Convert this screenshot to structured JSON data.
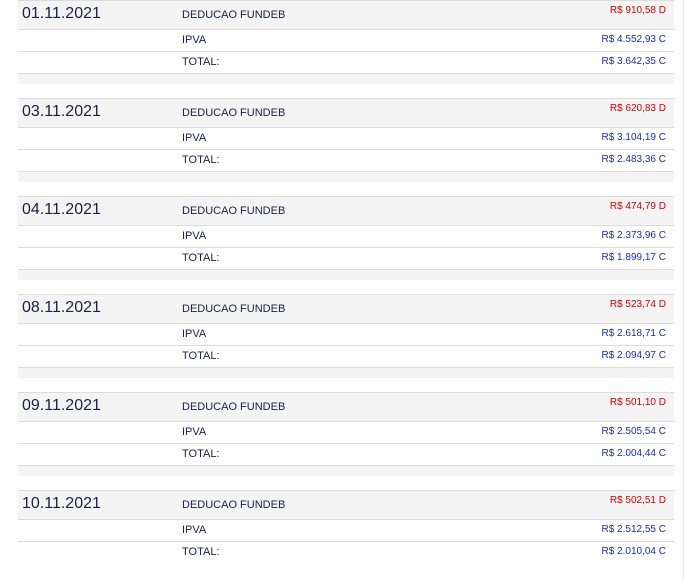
{
  "entries": [
    {
      "date": "01.11.2021",
      "rows": [
        {
          "label": "DEDUCAO FUNDEB",
          "value": "R$ 910,58 D"
        },
        {
          "label": "IPVA",
          "value": "R$ 4.552,93 C"
        },
        {
          "label": "TOTAL:",
          "value": "R$ 3.642,35 C"
        }
      ]
    },
    {
      "date": "03.11.2021",
      "rows": [
        {
          "label": "DEDUCAO FUNDEB",
          "value": "R$ 620,83 D"
        },
        {
          "label": "IPVA",
          "value": "R$ 3.104,19 C"
        },
        {
          "label": "TOTAL:",
          "value": "R$ 2.483,36 C"
        }
      ]
    },
    {
      "date": "04.11.2021",
      "rows": [
        {
          "label": "DEDUCAO FUNDEB",
          "value": "R$ 474,79 D"
        },
        {
          "label": "IPVA",
          "value": "R$ 2.373,96 C"
        },
        {
          "label": "TOTAL:",
          "value": "R$ 1.899,17 C"
        }
      ]
    },
    {
      "date": "08.11.2021",
      "rows": [
        {
          "label": "DEDUCAO FUNDEB",
          "value": "R$ 523,74 D"
        },
        {
          "label": "IPVA",
          "value": "R$ 2.618,71 C"
        },
        {
          "label": "TOTAL:",
          "value": "R$ 2.094,97 C"
        }
      ]
    },
    {
      "date": "09.11.2021",
      "rows": [
        {
          "label": "DEDUCAO FUNDEB",
          "value": "R$ 501,10 D"
        },
        {
          "label": "IPVA",
          "value": "R$ 2.505,54 C"
        },
        {
          "label": "TOTAL:",
          "value": "R$ 2.004,44 C"
        }
      ]
    },
    {
      "date": "10.11.2021",
      "rows": [
        {
          "label": "DEDUCAO FUNDEB",
          "value": "R$ 502,51 D"
        },
        {
          "label": "IPVA",
          "value": "R$ 2.512,55 C"
        },
        {
          "label": "TOTAL:",
          "value": "R$ 2.010,04 C"
        }
      ]
    }
  ],
  "colors": {
    "debit": "#d40000",
    "credit": "#1a2db0",
    "text": "#17214a",
    "row_bg": "#f4f4f4"
  }
}
